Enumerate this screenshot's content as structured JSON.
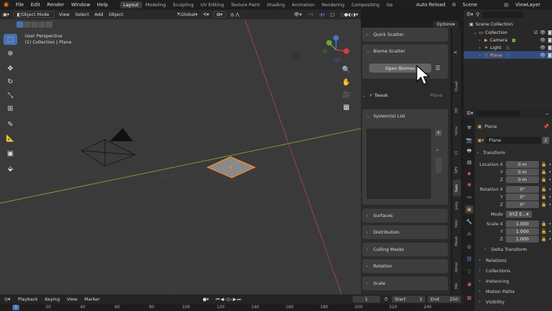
{
  "topbar": {
    "menus": [
      "File",
      "Edit",
      "Render",
      "Window",
      "Help"
    ],
    "workspaces": [
      "Layout",
      "Modeling",
      "Sculpting",
      "UV Editing",
      "Texture Paint",
      "Shading",
      "Animation",
      "Rendering",
      "Compositing",
      "Ge"
    ],
    "active_workspace": "Layout",
    "auto_reload": "Auto Reload",
    "scene": "Scene",
    "view_layer": "ViewLayer"
  },
  "viewport": {
    "mode": "Object Mode",
    "menus": [
      "View",
      "Select",
      "Add",
      "Object"
    ],
    "transform": "Global",
    "options": "Options",
    "info_line1": "User Perspective",
    "info_line2": "(1) Collection | Plane",
    "gizmo": {
      "x": "X",
      "y": "Y",
      "z": "Z"
    }
  },
  "npanel": {
    "quick_scatter": "Quick Scatter",
    "biome_scatter": "Biome Scatter",
    "open_biomes": "Open Biomes",
    "tweak": "Tweak",
    "tweak_object": "Plane",
    "systems_list": "System(s) List",
    "sections": [
      "Surfaces",
      "Distribution",
      "Culling Masks",
      "Rotation",
      "Scale"
    ]
  },
  "right_tabs": [
    "Quad",
    "3D",
    "Virtu",
    "Cl",
    "SPY",
    "Geo",
    "poly",
    "Hdri",
    "Mesh",
    "Atmo",
    "MA"
  ],
  "active_right_tab": "Geo",
  "outliner": {
    "scene_collection": "Scene Collection",
    "items": [
      {
        "label": "Collection",
        "depth": 1,
        "color": "#c8c8c8"
      },
      {
        "label": "Camera",
        "depth": 2,
        "color": "#e3a25c"
      },
      {
        "label": "Light",
        "depth": 2,
        "color": "#e3a25c"
      },
      {
        "label": "Plane",
        "depth": 2,
        "color": "#e3a25c"
      }
    ],
    "selected": "Plane"
  },
  "properties": {
    "object_name": "Plane",
    "data_name": "Plane",
    "users": "2",
    "transform_title": "Transform",
    "location_label": "Location X",
    "rotation_label": "Rotation X",
    "scale_label": "Scale X",
    "y_label": "Y",
    "z_label": "Z",
    "location": [
      "0 m",
      "0 m",
      "0 m"
    ],
    "rotation": [
      "0°",
      "0°",
      "0°"
    ],
    "mode_label": "Mode",
    "mode_value": "XYZ E...",
    "scale": [
      "1.000",
      "1.000",
      "1.000"
    ],
    "subsections": [
      "Delta Transform",
      "Relations",
      "Collections",
      "Instancing",
      "Motion Paths",
      "Visibility"
    ]
  },
  "timeline": {
    "menus": [
      "Playback",
      "Keying",
      "View",
      "Marker"
    ],
    "current_frame": "1",
    "start_label": "Start",
    "start": "1",
    "end_label": "End",
    "end": "250",
    "ruler": [
      "1",
      "20",
      "40",
      "60",
      "80",
      "100",
      "120",
      "140",
      "160",
      "180",
      "200",
      "220",
      "240"
    ]
  },
  "colors": {
    "accent": "#4772b3",
    "selected_orange": "#e88a2e",
    "viewport_bg": "#3a3a3a"
  }
}
